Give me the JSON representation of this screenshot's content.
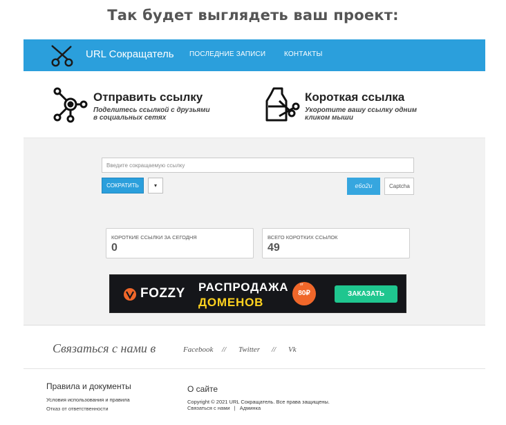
{
  "headline": "Так будет выглядеть ваш проект:",
  "navbar": {
    "brand": "URL Сокращатель",
    "links": [
      "ПОСЛЕДНИЕ ЗАПИСИ",
      "КОНТАКТЫ"
    ],
    "logo_icon": "scissors-icon"
  },
  "features": [
    {
      "icon": "share-network-icon",
      "title": "Отправить ссылку",
      "desc_line1": "Поделитесь ссылкой с друзьями",
      "desc_line2": "в социальных сетях"
    },
    {
      "icon": "cut-link-icon",
      "title": "Короткая ссылка",
      "desc_line1": "Укоротите вашу ссылку одним",
      "desc_line2": "кликом мыши"
    }
  ],
  "shortener": {
    "url_placeholder": "Введите сокращаемую ссылку",
    "shorten_label": "СОКРАТИТЬ",
    "dropdown_label": "▾",
    "captcha_text": "e6o2u",
    "captcha_placeholder": "Captcha"
  },
  "stats": [
    {
      "label": "КОРОТКИЕ ССЫЛКИ ЗА СЕГОДНЯ",
      "value": "0"
    },
    {
      "label": "ВСЕГО КОРОТКИХ ССЫЛОК",
      "value": "49"
    }
  ],
  "banner": {
    "logo": "FOZZY",
    "line1": "РАСПРОДАЖА",
    "line2": "ДОМЕНОВ",
    "price_prefix": "от",
    "price": "80₽",
    "cta": "ЗАКАЗАТЬ",
    "colors": {
      "bg": "#15161a",
      "accent": "#ffd21f",
      "price": "#f0672a",
      "cta": "#1fc68f"
    }
  },
  "social": {
    "heading": "Связаться с нами в",
    "links": [
      "Facebook",
      "Twitter",
      "Vk"
    ],
    "separator": "//"
  },
  "footer": {
    "docs_title": "Правила и документы",
    "docs_links": [
      "Условия использования и правила",
      "Отказ от ответственности"
    ],
    "about_title": "О сайте",
    "copyright": "Copyright © 2021 URL Сокращатель. Все права защищены.",
    "contact_link": "Связаться с нами",
    "pipe": "|",
    "admin_link": "Админка"
  },
  "colors": {
    "navbar": "#2b9fdc",
    "page_bg": "#f2f2f2"
  }
}
